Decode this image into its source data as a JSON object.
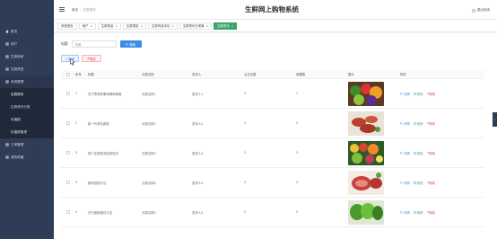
{
  "app_title": "生鲜网上购物系统",
  "logout_label": "退出系统",
  "breadcrumb": {
    "home": "首页",
    "current": "生鲜资讯"
  },
  "sidebar": {
    "items": [
      {
        "label": "首页",
        "icon": "home-icon"
      },
      {
        "label": "用户",
        "icon": "grid-icon"
      },
      {
        "label": "生鲜商家",
        "icon": "grid-icon"
      },
      {
        "label": "生鲜类型",
        "icon": "grid-icon"
      },
      {
        "label": "系统管理",
        "icon": "grid-icon",
        "expanded": true
      }
    ],
    "subitems": [
      {
        "label": "生鲜资讯",
        "selected": true
      },
      {
        "label": "生鲜资讯分类"
      },
      {
        "label": "轮播图"
      },
      {
        "label": "轮播图管理"
      }
    ],
    "bottom_items": [
      {
        "label": "订单管理",
        "icon": "grid-icon"
      },
      {
        "label": "我的收藏",
        "icon": "grid-icon"
      }
    ]
  },
  "tabs": [
    {
      "label": "系统首页",
      "active": false
    },
    {
      "label": "用户",
      "active": false
    },
    {
      "label": "生鲜商品",
      "active": false
    },
    {
      "label": "生鲜类型",
      "active": false
    },
    {
      "label": "生鲜商品评论",
      "active": false
    },
    {
      "label": "生鲜资讯分类管",
      "active": false
    },
    {
      "label": "生鲜资讯",
      "active": true
    }
  ],
  "search": {
    "label": "标题",
    "placeholder": "标题",
    "button": "搜索"
  },
  "actions": {
    "add": "新增",
    "delete": "删除"
  },
  "table": {
    "headers": [
      "序号",
      "标题",
      "分类名称",
      "发布人",
      "点击次数",
      "收藏数",
      "图片",
      "操作"
    ],
    "rows": [
      {
        "idx": "1",
        "title": "关于思考鲜果采摘和种植",
        "category": "分类名称1",
        "publisher": "发布人1",
        "clicks": "1",
        "favs": "1",
        "image": "vegetables"
      },
      {
        "idx": "2",
        "title": "新一代有机蔬菜",
        "category": "分类名称2",
        "publisher": "发布人2",
        "clicks": "2",
        "favs": "2",
        "image": "meat-skewers"
      },
      {
        "idx": "3",
        "title": "简介生鲜类商品的知识",
        "category": "分类名称3",
        "publisher": "发布人3",
        "clicks": "3",
        "favs": "3",
        "image": "mixed-produce"
      },
      {
        "idx": "4",
        "title": "鲜肉选购方法",
        "category": "分类名称4",
        "publisher": "发布人4",
        "clicks": "4",
        "favs": "4",
        "image": "raw-meat"
      },
      {
        "idx": "5",
        "title": "关于蔬菜储存方法",
        "category": "分类名称5",
        "publisher": "发布人5",
        "clicks": "5",
        "favs": "5",
        "image": "leafy-greens"
      }
    ],
    "ops": {
      "view": "详情",
      "edit": "修改",
      "delete": "删除"
    }
  },
  "colors": {
    "sidebar": "#2f3c55",
    "accent_green": "#3aa36b",
    "accent_blue": "#3a8ee6",
    "danger": "#e55050"
  }
}
